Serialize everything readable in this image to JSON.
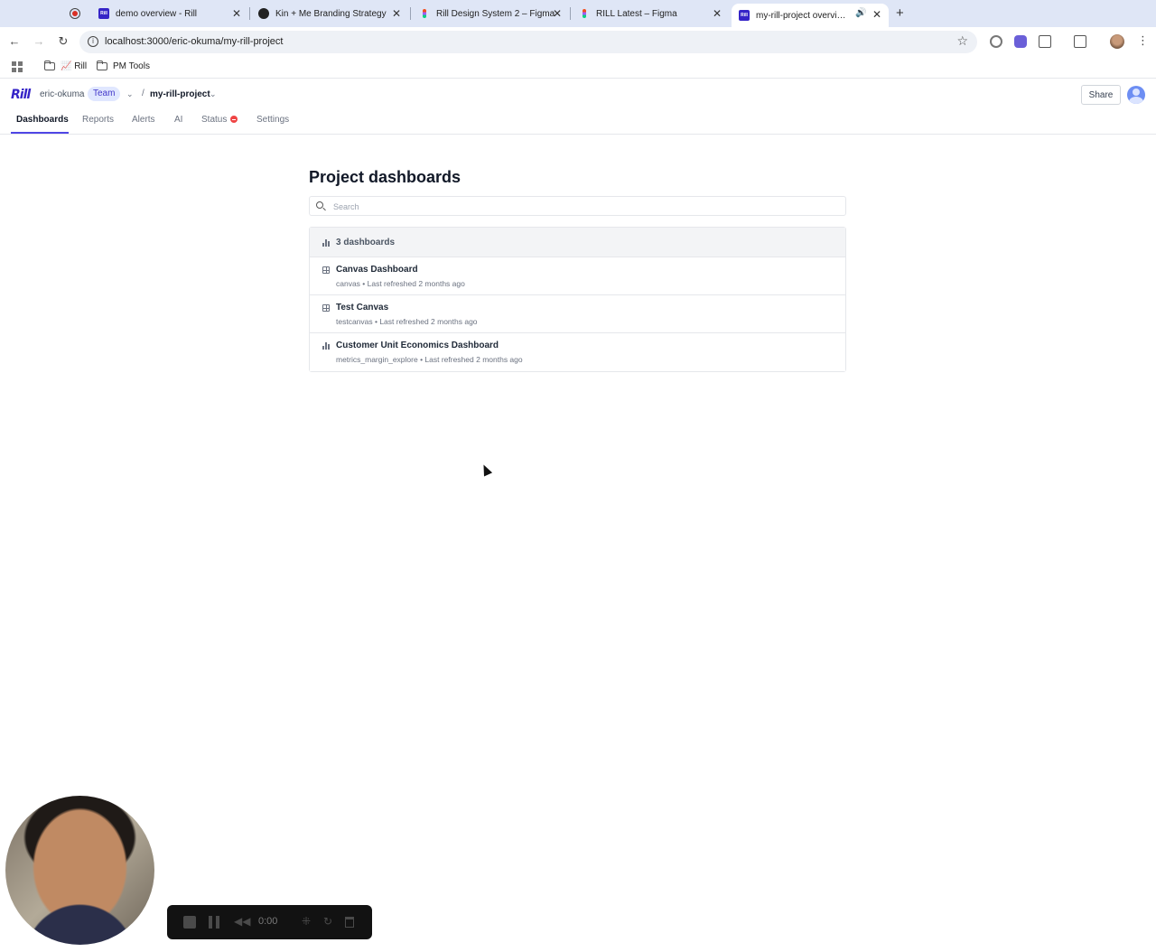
{
  "browser": {
    "tabs": [
      {
        "title": "demo overview - Rill",
        "icon": "rill-favicon"
      },
      {
        "title": "Kin + Me Branding Strategy",
        "icon": "kin-favicon"
      },
      {
        "title": "Rill Design System 2 – Figma",
        "icon": "figma-favicon"
      },
      {
        "title": "RILL Latest – Figma",
        "icon": "figma-favicon"
      },
      {
        "title": "my-rill-project overview -",
        "icon": "rill-favicon"
      }
    ],
    "url": "localhost:3000/eric-okuma/my-rill-project",
    "bookmarks": [
      {
        "label": "📈 Rill"
      },
      {
        "label": "PM Tools"
      }
    ]
  },
  "header": {
    "logo": "Rill",
    "org": "eric-okuma",
    "org_badge": "Team",
    "separator": "/",
    "project": "my-rill-project",
    "share_label": "Share"
  },
  "nav": {
    "tabs": [
      {
        "label": "Dashboards",
        "active": true
      },
      {
        "label": "Reports"
      },
      {
        "label": "Alerts"
      },
      {
        "label": "AI"
      },
      {
        "label": "Status"
      },
      {
        "label": "Settings"
      }
    ]
  },
  "main": {
    "title": "Project dashboards",
    "search_placeholder": "Search",
    "count_label": "3 dashboards",
    "dashboards": [
      {
        "name": "Canvas Dashboard",
        "meta": "canvas • Last refreshed 2 months ago",
        "icon": "canvas-icon"
      },
      {
        "name": "Test Canvas",
        "meta": "testcanvas • Last refreshed 2 months ago",
        "icon": "canvas-icon"
      },
      {
        "name": "Customer Unit Economics Dashboard",
        "meta": "metrics_margin_explore • Last refreshed 2 months ago",
        "icon": "explore-icon"
      }
    ]
  },
  "recorder": {
    "time": "0:00"
  },
  "colors": {
    "accent": "#4f46e5",
    "brand": "#3524c7",
    "status_error": "#ef4444",
    "tabstrip": "#dfe6f6"
  }
}
